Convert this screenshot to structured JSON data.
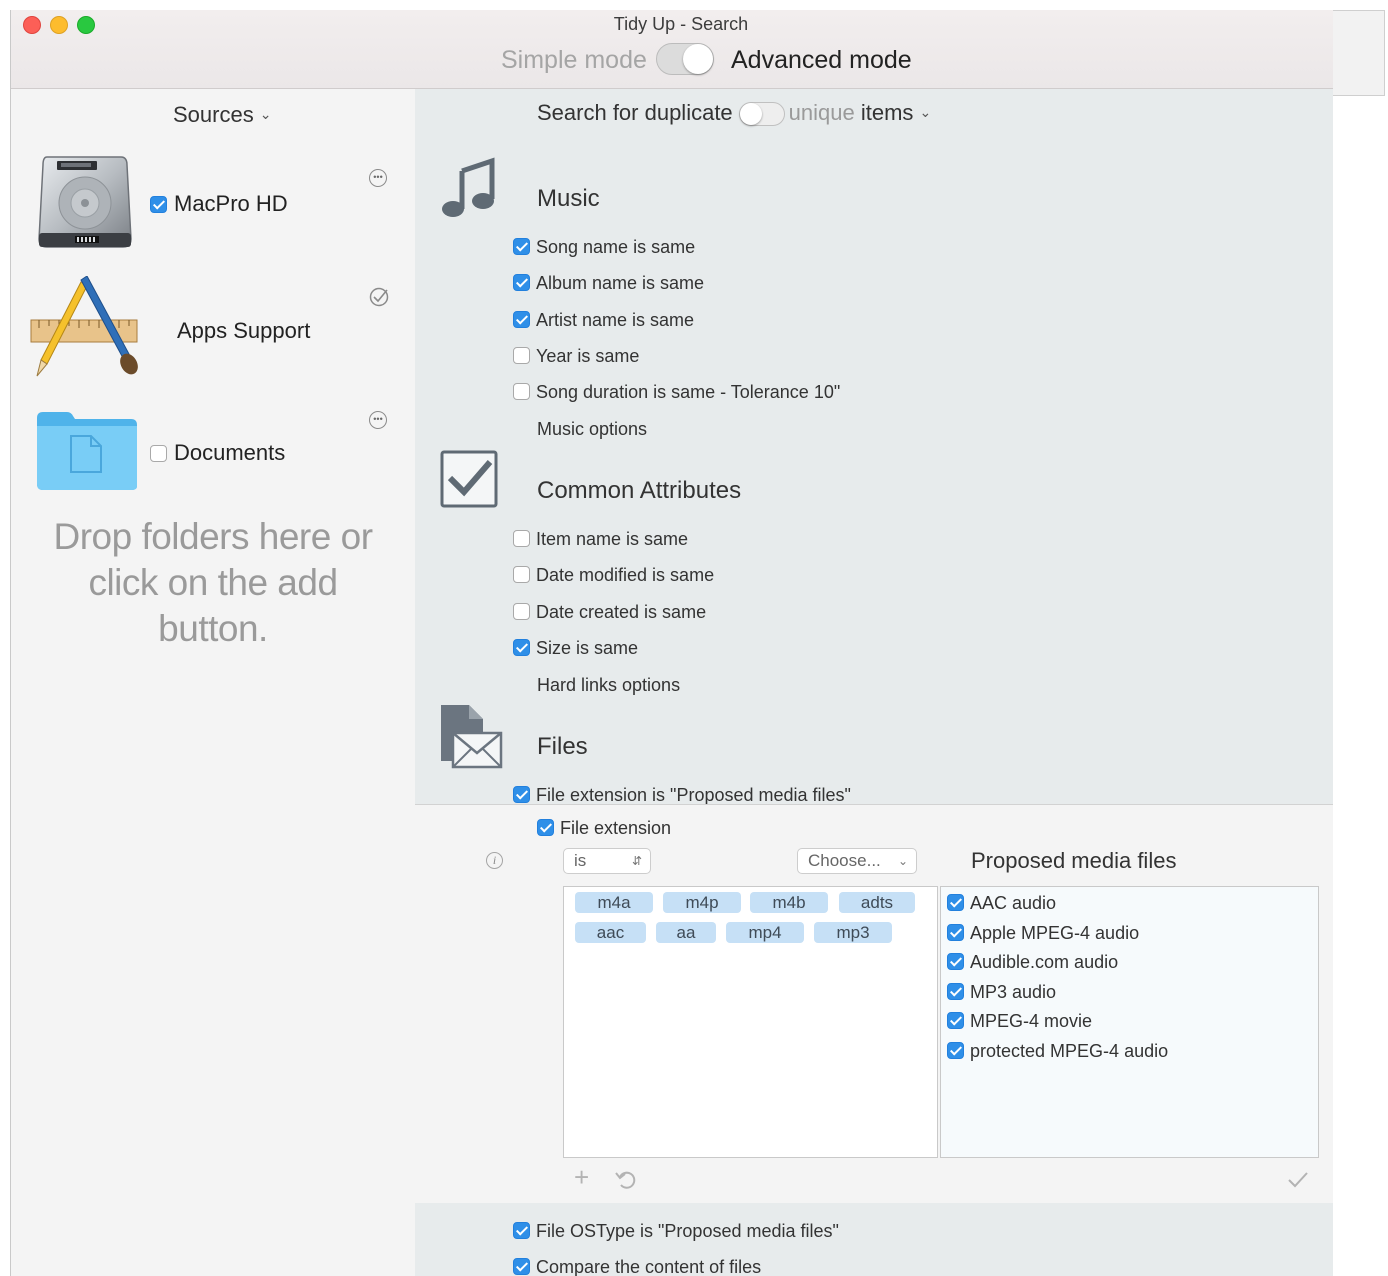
{
  "window": {
    "title": "Tidy Up - Search"
  },
  "mode": {
    "simple_label": "Simple mode",
    "advanced_label": "Advanced mode",
    "selected": "advanced"
  },
  "sources": {
    "header": "Sources",
    "items": [
      {
        "label": "MacPro HD",
        "checked": true,
        "action_icon": "more-icon"
      },
      {
        "label": "Apps Support",
        "checked": null,
        "action_icon": "checkmark-circle-icon"
      },
      {
        "label": "Documents",
        "checked": false,
        "action_icon": "more-icon"
      }
    ],
    "drop_hint_line1": "Drop folders here or",
    "drop_hint_line2": "click on the add button."
  },
  "search": {
    "prefix": "Search for duplicate",
    "toggle_off_label": "unique",
    "suffix": "items"
  },
  "music": {
    "title": "Music",
    "options": [
      {
        "label": "Song name is same",
        "checked": true
      },
      {
        "label": "Album name is same",
        "checked": true
      },
      {
        "label": "Artist name is same",
        "checked": true
      },
      {
        "label": "Year is same",
        "checked": false
      },
      {
        "label": "Song duration is same - Tolerance 10\"",
        "checked": false
      }
    ],
    "options_link": "Music options"
  },
  "common": {
    "title": "Common Attributes",
    "options": [
      {
        "label": "Item name is same",
        "checked": false
      },
      {
        "label": "Date modified is same",
        "checked": false
      },
      {
        "label": "Date created is same",
        "checked": false
      },
      {
        "label": "Size is same",
        "checked": true
      }
    ],
    "options_link": "Hard links options"
  },
  "files": {
    "title": "Files",
    "ext_option": {
      "label": "File extension is \"Proposed media files\"",
      "checked": true
    },
    "file_extension": {
      "label": "File extension",
      "checked": true,
      "operator": "is",
      "choose_label": "Choose...",
      "extensions": [
        "m4a",
        "m4p",
        "m4b",
        "adts",
        "aac",
        "aa",
        "mp4",
        "mp3"
      ],
      "proposed_title": "Proposed media files",
      "proposed": [
        {
          "label": "AAC audio",
          "checked": true
        },
        {
          "label": "Apple MPEG-4 audio",
          "checked": true
        },
        {
          "label": "Audible.com audio",
          "checked": true
        },
        {
          "label": "MP3 audio",
          "checked": true
        },
        {
          "label": "MPEG-4 movie",
          "checked": true
        },
        {
          "label": "protected MPEG-4 audio",
          "checked": true
        }
      ]
    },
    "ostype_option": {
      "label": "File OSType is \"Proposed media files\"",
      "checked": true
    },
    "content_option": {
      "label": "Compare the content of files",
      "checked": true
    }
  },
  "colors": {
    "accent": "#2f8fe8",
    "token_bg": "#c6e0f6",
    "right_panel_bg": "#e7ebec"
  }
}
